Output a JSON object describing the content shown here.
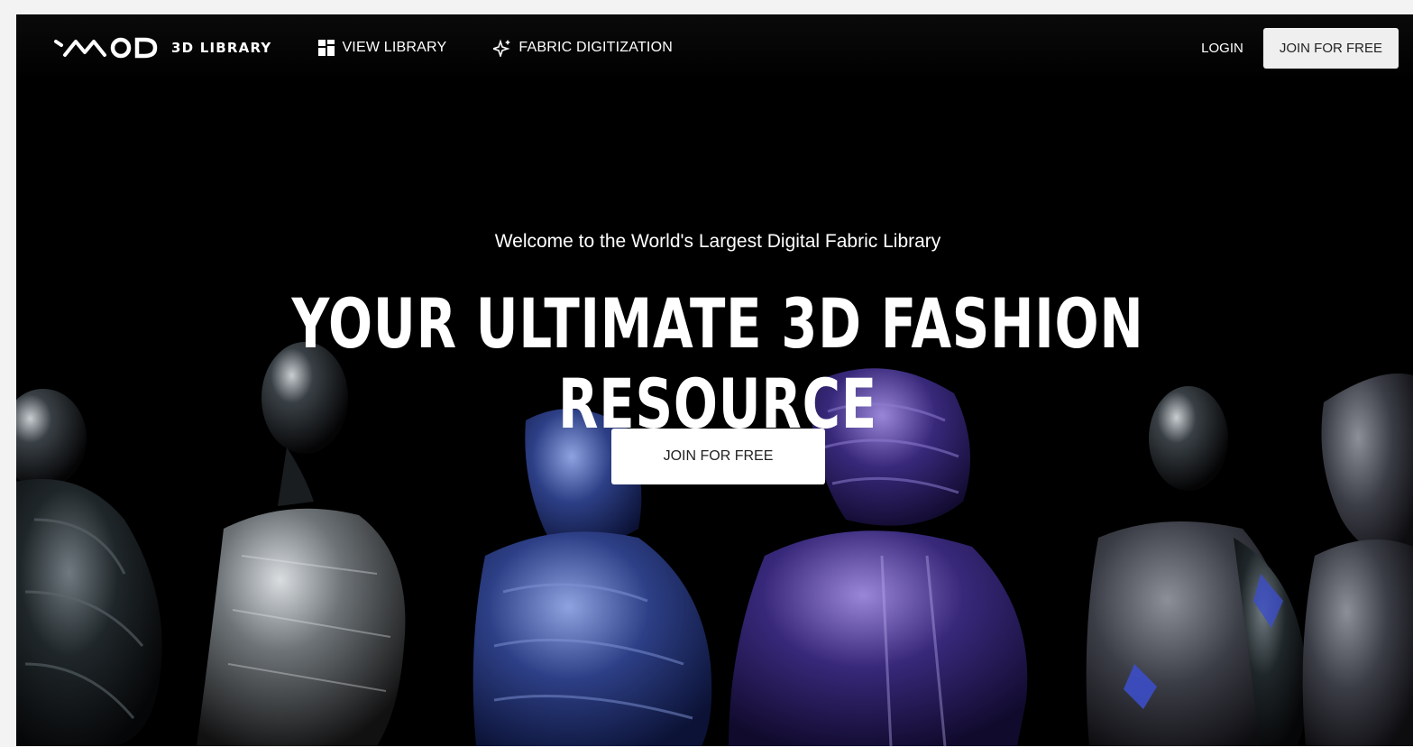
{
  "header": {
    "brand_name": "3D LIBRARY",
    "nav_items": [
      {
        "label": "VIEW LIBRARY",
        "icon": "grid-icon"
      },
      {
        "label": "FABRIC DIGITIZATION",
        "icon": "sparkle-icon"
      }
    ],
    "login_label": "LOGIN",
    "join_label": "JOIN FOR FREE"
  },
  "hero": {
    "subtitle": "Welcome to the World's Largest Digital Fabric Library",
    "headline": "YOUR ULTIMATE 3D FASHION RESOURCE",
    "cta_label": "JOIN FOR FREE"
  },
  "colors": {
    "background": "#000000",
    "text": "#ffffff",
    "button_bg": "#ffffff",
    "accent_blue": "#2e3f86",
    "accent_purple": "#3a2a78"
  }
}
